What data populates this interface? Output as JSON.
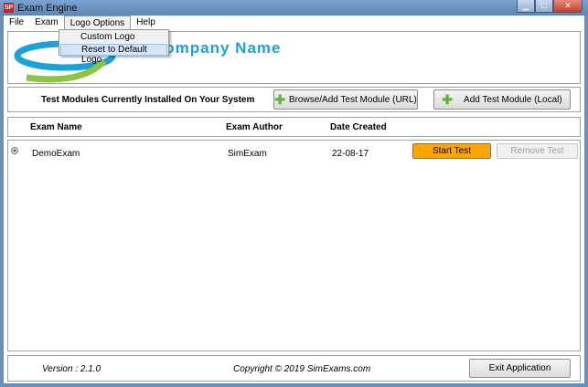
{
  "window": {
    "title": "Exam Engine",
    "icon": "sp-logo-icon"
  },
  "menu": {
    "items": [
      "File",
      "Exam",
      "Logo Options",
      "Help"
    ],
    "dropdown": [
      "Custom Logo",
      "Reset to Default Logo"
    ]
  },
  "logo": {
    "company": "Company Name",
    "colors": [
      "#1aa3d9",
      "#8cc63f"
    ]
  },
  "modules": {
    "label": "Test Modules Currently Installed On Your System",
    "browse": "Browse/Add Test Module (URL)",
    "add_local": "Add Test Module (Local)"
  },
  "table": {
    "headers": [
      "Exam Name",
      "Exam Author",
      "Date Created"
    ],
    "rows": [
      {
        "name": "DemoExam",
        "author": "SimExam",
        "date": "22-08-17",
        "start": "Start Test",
        "remove": "Remove Test"
      }
    ]
  },
  "footer": {
    "version": "Version : 2.1.0",
    "copyright": "Copyright © 2019 SimExams.com",
    "exit": "Exit Application"
  },
  "colors": {
    "start": "#ffa500",
    "titlebar": "#6a90b8"
  }
}
